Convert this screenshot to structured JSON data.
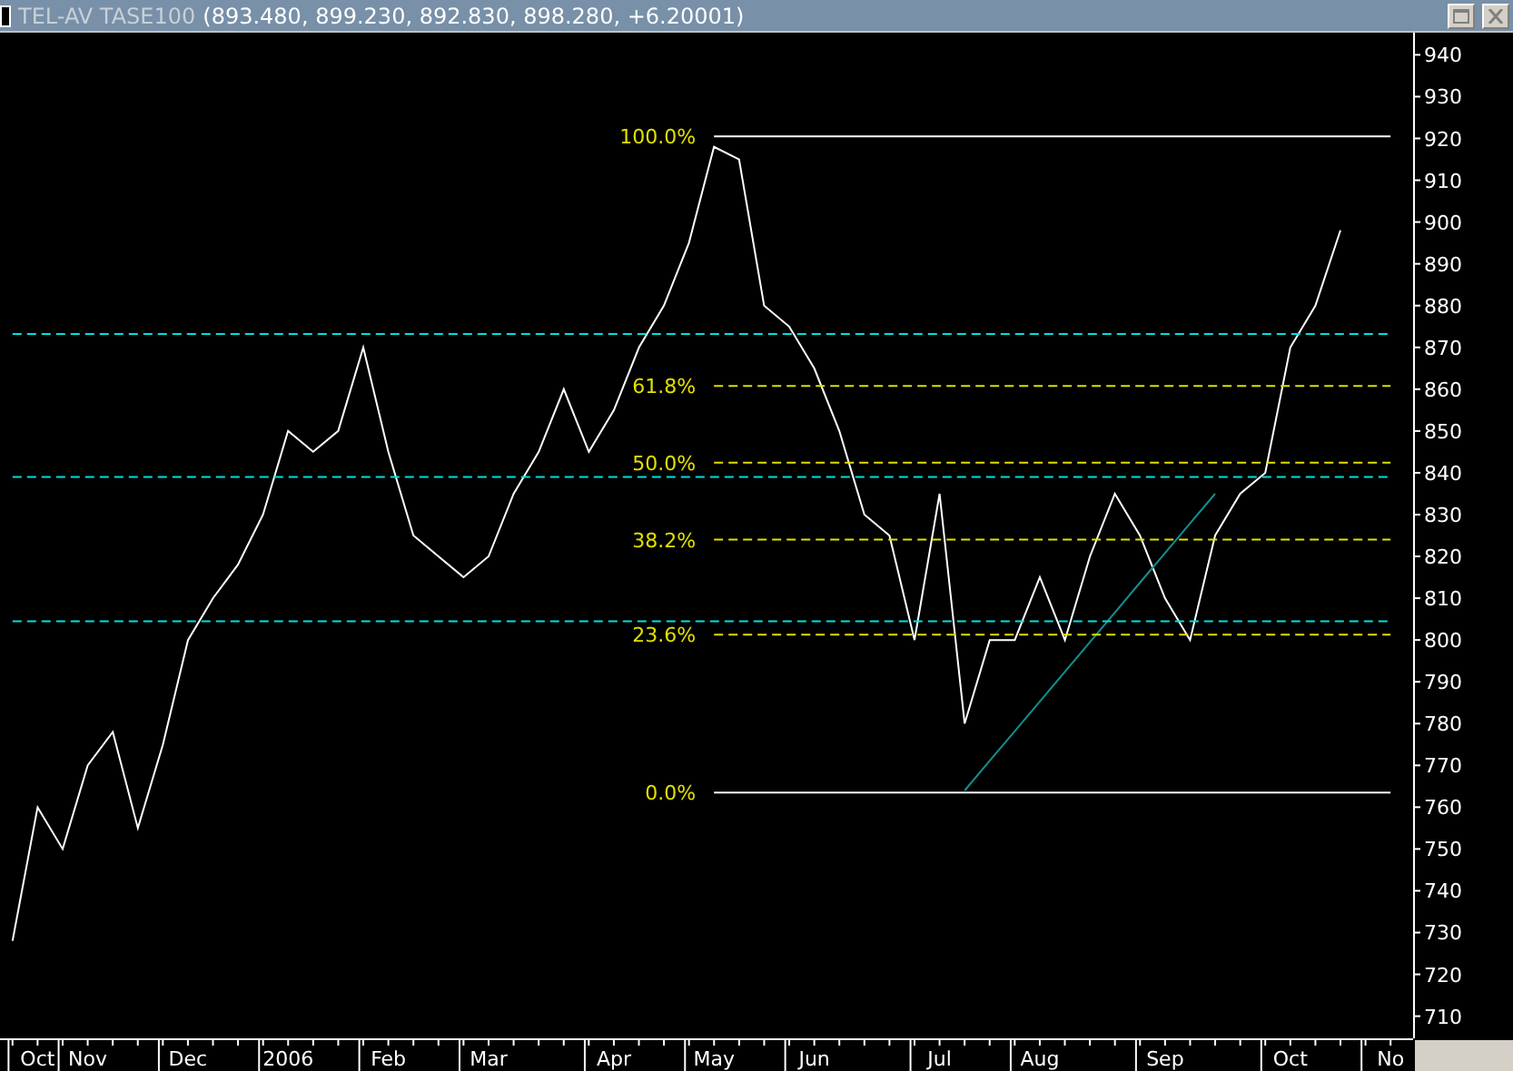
{
  "window": {
    "quote": "(893.480, 899.230, 892.830, 898.280, +6.20001)"
  },
  "chart": {
    "chart_data": {
      "type": "line",
      "categories": [
        null,
        "Oct",
        null,
        "Nov",
        null,
        null,
        null,
        "Dec",
        null,
        null,
        null,
        "2006",
        null,
        null,
        null,
        "Feb",
        null,
        null,
        null,
        "Mar",
        null,
        null,
        null,
        null,
        "Apr",
        null,
        null,
        null,
        "May",
        null,
        null,
        null,
        "Jun",
        null,
        null,
        null,
        null,
        "Jul",
        null,
        null,
        null,
        "Aug",
        null,
        null,
        null,
        null,
        "Sep",
        null,
        null,
        null,
        null,
        "Oct",
        null,
        null,
        null,
        "No"
      ],
      "series": [
        {
          "name": "TEL-AV TASE100",
          "color": "#ffffff",
          "values": [
            728,
            760,
            750,
            770,
            778,
            755,
            775,
            800,
            810,
            818,
            830,
            850,
            845,
            850,
            870,
            845,
            825,
            820,
            815,
            820,
            835,
            845,
            860,
            845,
            855,
            870,
            880,
            895,
            918,
            915,
            880,
            875,
            865,
            850,
            830,
            825,
            800,
            835,
            780,
            800,
            800,
            815,
            800,
            820,
            835,
            825,
            810,
            800,
            825,
            835,
            840,
            870,
            880,
            898,
            null,
            null
          ]
        },
        {
          "color": "#109090",
          "values": [
            null,
            null,
            null,
            null,
            null,
            null,
            null,
            null,
            null,
            null,
            null,
            null,
            null,
            null,
            null,
            null,
            null,
            null,
            null,
            null,
            null,
            null,
            null,
            null,
            null,
            null,
            null,
            null,
            null,
            null,
            null,
            null,
            null,
            null,
            null,
            null,
            null,
            null,
            764,
            771.1,
            778.2,
            785.3,
            792.4,
            799.5,
            806.6,
            813.7,
            820.8,
            827.9,
            835,
            null,
            null,
            null,
            null,
            null,
            null,
            null
          ]
        },
        {
          "color": "#00e0e0",
          "line_style": "dashed",
          "values": [
            873.2,
            873.2,
            873.2,
            873.2,
            873.2,
            873.2,
            873.2,
            873.2,
            873.2,
            873.2,
            873.2,
            873.2,
            873.2,
            873.2,
            873.2,
            873.2,
            873.2,
            873.2,
            873.2,
            873.2,
            873.2,
            873.2,
            873.2,
            873.2,
            873.2,
            873.2,
            873.2,
            873.2,
            873.2,
            873.2,
            873.2,
            873.2,
            873.2,
            873.2,
            873.2,
            873.2,
            873.2,
            873.2,
            873.2,
            873.2,
            873.2,
            873.2,
            873.2,
            873.2,
            873.2,
            873.2,
            873.2,
            873.2,
            873.2,
            873.2,
            873.2,
            873.2,
            873.2,
            873.2,
            873.2,
            873.2
          ]
        },
        {
          "color": "#00e0e0",
          "line_style": "dashed",
          "values": [
            839,
            839,
            839,
            839,
            839,
            839,
            839,
            839,
            839,
            839,
            839,
            839,
            839,
            839,
            839,
            839,
            839,
            839,
            839,
            839,
            839,
            839,
            839,
            839,
            839,
            839,
            839,
            839,
            839,
            839,
            839,
            839,
            839,
            839,
            839,
            839,
            839,
            839,
            839,
            839,
            839,
            839,
            839,
            839,
            839,
            839,
            839,
            839,
            839,
            839,
            839,
            839,
            839,
            839,
            839,
            839
          ]
        },
        {
          "color": "#00e0e0",
          "line_style": "dashed",
          "values": [
            804.5,
            804.5,
            804.5,
            804.5,
            804.5,
            804.5,
            804.5,
            804.5,
            804.5,
            804.5,
            804.5,
            804.5,
            804.5,
            804.5,
            804.5,
            804.5,
            804.5,
            804.5,
            804.5,
            804.5,
            804.5,
            804.5,
            804.5,
            804.5,
            804.5,
            804.5,
            804.5,
            804.5,
            804.5,
            804.5,
            804.5,
            804.5,
            804.5,
            804.5,
            804.5,
            804.5,
            804.5,
            804.5,
            804.5,
            804.5,
            804.5,
            804.5,
            804.5,
            804.5,
            804.5,
            804.5,
            804.5,
            804.5,
            804.5,
            804.5,
            804.5,
            804.5,
            804.5,
            804.5,
            804.5,
            804.5
          ]
        },
        {
          "name": "100.0%",
          "color": "#ffffff",
          "values": [
            null,
            null,
            null,
            null,
            null,
            null,
            null,
            null,
            null,
            null,
            null,
            null,
            null,
            null,
            null,
            null,
            null,
            null,
            null,
            null,
            null,
            null,
            null,
            null,
            null,
            null,
            null,
            null,
            920.5,
            920.5,
            920.5,
            920.5,
            920.5,
            920.5,
            920.5,
            920.5,
            920.5,
            920.5,
            920.5,
            920.5,
            920.5,
            920.5,
            920.5,
            920.5,
            920.5,
            920.5,
            920.5,
            920.5,
            920.5,
            920.5,
            920.5,
            920.5,
            920.5,
            920.5,
            920.5,
            920.5
          ]
        },
        {
          "name": "61.8%",
          "color": "#e0e000",
          "line_style": "dashed",
          "values": [
            null,
            null,
            null,
            null,
            null,
            null,
            null,
            null,
            null,
            null,
            null,
            null,
            null,
            null,
            null,
            null,
            null,
            null,
            null,
            null,
            null,
            null,
            null,
            null,
            null,
            null,
            null,
            null,
            860.8,
            860.8,
            860.8,
            860.8,
            860.8,
            860.8,
            860.8,
            860.8,
            860.8,
            860.8,
            860.8,
            860.8,
            860.8,
            860.8,
            860.8,
            860.8,
            860.8,
            860.8,
            860.8,
            860.8,
            860.8,
            860.8,
            860.8,
            860.8,
            860.8,
            860.8,
            860.8,
            860.8
          ]
        },
        {
          "name": "50.0%",
          "color": "#e0e000",
          "line_style": "dashed",
          "values": [
            null,
            null,
            null,
            null,
            null,
            null,
            null,
            null,
            null,
            null,
            null,
            null,
            null,
            null,
            null,
            null,
            null,
            null,
            null,
            null,
            null,
            null,
            null,
            null,
            null,
            null,
            null,
            null,
            842.4,
            842.4,
            842.4,
            842.4,
            842.4,
            842.4,
            842.4,
            842.4,
            842.4,
            842.4,
            842.4,
            842.4,
            842.4,
            842.4,
            842.4,
            842.4,
            842.4,
            842.4,
            842.4,
            842.4,
            842.4,
            842.4,
            842.4,
            842.4,
            842.4,
            842.4,
            842.4,
            842.4
          ]
        },
        {
          "name": "38.2%",
          "color": "#e0e000",
          "line_style": "dashed",
          "values": [
            null,
            null,
            null,
            null,
            null,
            null,
            null,
            null,
            null,
            null,
            null,
            null,
            null,
            null,
            null,
            null,
            null,
            null,
            null,
            null,
            null,
            null,
            null,
            null,
            null,
            null,
            null,
            null,
            824,
            824,
            824,
            824,
            824,
            824,
            824,
            824,
            824,
            824,
            824,
            824,
            824,
            824,
            824,
            824,
            824,
            824,
            824,
            824,
            824,
            824,
            824,
            824,
            824,
            824,
            824,
            824
          ]
        },
        {
          "name": "23.6%",
          "color": "#e0e000",
          "line_style": "dashed",
          "values": [
            null,
            null,
            null,
            null,
            null,
            null,
            null,
            null,
            null,
            null,
            null,
            null,
            null,
            null,
            null,
            null,
            null,
            null,
            null,
            null,
            null,
            null,
            null,
            null,
            null,
            null,
            null,
            null,
            801.3,
            801.3,
            801.3,
            801.3,
            801.3,
            801.3,
            801.3,
            801.3,
            801.3,
            801.3,
            801.3,
            801.3,
            801.3,
            801.3,
            801.3,
            801.3,
            801.3,
            801.3,
            801.3,
            801.3,
            801.3,
            801.3,
            801.3,
            801.3,
            801.3,
            801.3,
            801.3,
            801.3
          ]
        },
        {
          "name": "0.0%",
          "color": "#ffffff",
          "values": [
            null,
            null,
            null,
            null,
            null,
            null,
            null,
            null,
            null,
            null,
            null,
            null,
            null,
            null,
            null,
            null,
            null,
            null,
            null,
            null,
            null,
            null,
            null,
            null,
            null,
            null,
            null,
            null,
            763.5,
            763.5,
            763.5,
            763.5,
            763.5,
            763.5,
            763.5,
            763.5,
            763.5,
            763.5,
            763.5,
            763.5,
            763.5,
            763.5,
            763.5,
            763.5,
            763.5,
            763.5,
            763.5,
            763.5,
            763.5,
            763.5,
            763.5,
            763.5,
            763.5,
            763.5,
            763.5,
            763.5
          ]
        }
      ],
      "ylim": [
        704.7,
        945.3
      ],
      "yticks": [
        710,
        720,
        730,
        740,
        750,
        760,
        770,
        780,
        790,
        800,
        810,
        820,
        830,
        840,
        850,
        860,
        870,
        880,
        890,
        900,
        910,
        920,
        930,
        940
      ]
    }
  }
}
